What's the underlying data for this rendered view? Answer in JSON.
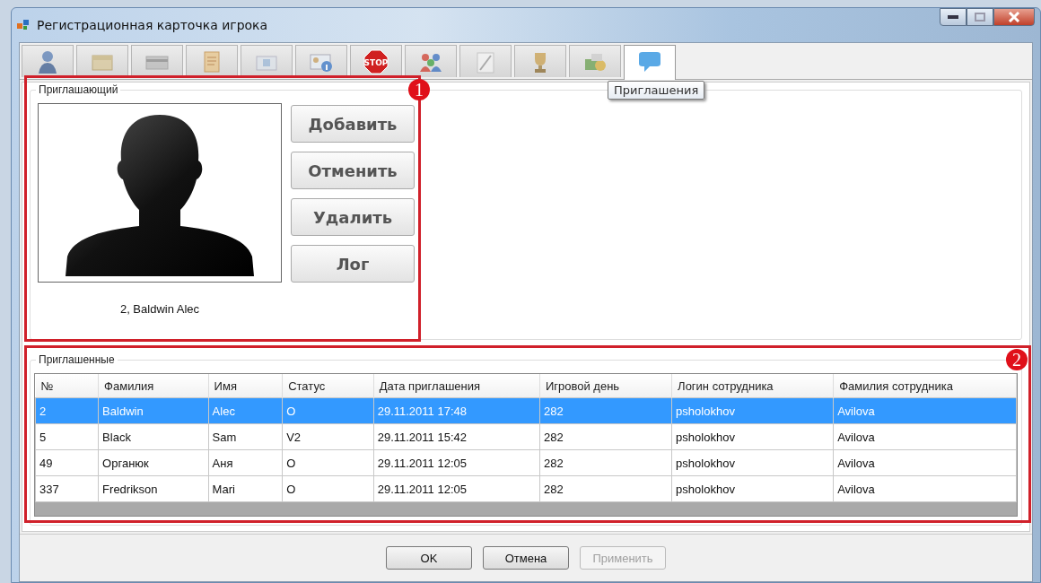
{
  "window": {
    "title": "Регистрационная карточка игрока"
  },
  "tabs": [
    {
      "kind": "person",
      "selected": false
    },
    {
      "kind": "box",
      "selected": false
    },
    {
      "kind": "card",
      "selected": false
    },
    {
      "kind": "document",
      "selected": false
    },
    {
      "kind": "folder",
      "selected": false
    },
    {
      "kind": "id",
      "selected": false
    },
    {
      "kind": "stop",
      "icon_text": "STOP",
      "selected": false
    },
    {
      "kind": "people",
      "selected": false
    },
    {
      "kind": "pen",
      "selected": false
    },
    {
      "kind": "trophy",
      "selected": false
    },
    {
      "kind": "money",
      "selected": false
    },
    {
      "kind": "chat",
      "selected": true
    }
  ],
  "tooltip": "Приглашения",
  "inviter": {
    "legend": "Приглашающий",
    "caption": "2, Baldwin Alec",
    "buttons": [
      {
        "label": "Добавить"
      },
      {
        "label": "Отменить"
      },
      {
        "label": "Удалить"
      },
      {
        "label": "Лог"
      }
    ]
  },
  "invited": {
    "legend": "Приглашенные",
    "columns": [
      "№",
      "Фамилия",
      "Имя",
      "Статус",
      "Дата приглашения",
      "Игровой день",
      "Логин сотрудника",
      "Фамилия сотрудника"
    ],
    "rows": [
      {
        "selected": true,
        "cells": [
          "2",
          "Baldwin",
          "Alec",
          "O",
          "29.11.2011 17:48",
          "282",
          "psholokhov",
          "Avilova"
        ]
      },
      {
        "selected": false,
        "cells": [
          "5",
          "Black",
          "Sam",
          "V2",
          "29.11.2011 15:42",
          "282",
          "psholokhov",
          "Avilova"
        ]
      },
      {
        "selected": false,
        "cells": [
          "49",
          "Органюк",
          "Аня",
          "O",
          "29.11.2011 12:05",
          "282",
          "psholokhov",
          "Avilova"
        ]
      },
      {
        "selected": false,
        "cells": [
          "337",
          "Fredrikson",
          "Mari",
          "O",
          "29.11.2011 12:05",
          "282",
          "psholokhov",
          "Avilova"
        ]
      }
    ]
  },
  "callouts": [
    {
      "number": "1"
    },
    {
      "number": "2"
    }
  ],
  "footer_buttons": [
    {
      "label": "OK",
      "disabled": false
    },
    {
      "label": "Отмена",
      "disabled": false
    },
    {
      "label": "Применить",
      "disabled": true
    }
  ]
}
